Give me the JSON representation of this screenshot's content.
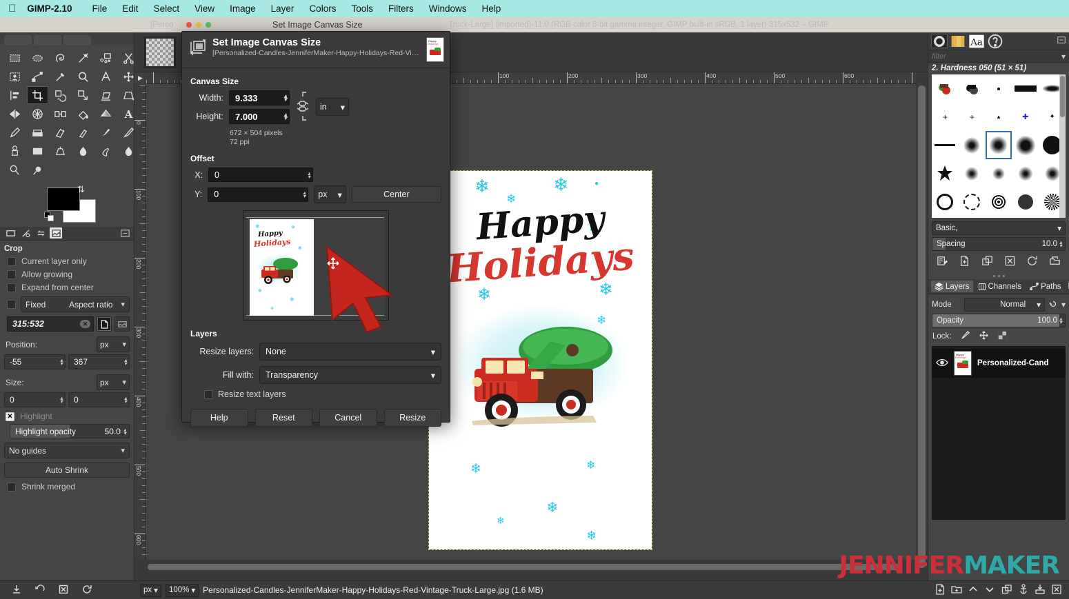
{
  "macbar": {
    "apple_icon": "apple-icon",
    "app_name": "GIMP-2.10",
    "menus": [
      "File",
      "Edit",
      "Select",
      "View",
      "Image",
      "Layer",
      "Colors",
      "Tools",
      "Filters",
      "Windows",
      "Help"
    ]
  },
  "titlebar": {
    "left_text": "[Perso",
    "center_text": "Set Image Canvas Size",
    "right_text": "Truck-Large] (imported)-11.0 (RGB color 8-bit gamma integer, GIMP built-in sRGB, 1 layer) 315x532 – GIMP",
    "close_color": "#f2544a",
    "min_color": "#f3bd4e",
    "max_color": "#5ec45a"
  },
  "toolbox": {
    "tools": [
      "rect-select-icon",
      "ellipse-select-icon",
      "free-select-icon",
      "fuzzy-select-icon",
      "select-by-color-icon",
      "scissors-select-icon",
      "foreground-select-icon",
      "paths-icon",
      "color-picker-icon",
      "zoom-icon",
      "measure-icon",
      "move-icon",
      "alignment-icon",
      "crop-icon",
      "rotate-icon",
      "scale-icon",
      "shear-icon",
      "perspective-icon",
      "flip-icon",
      "cage-transform-icon",
      "warp-transform-icon",
      "bucket-fill-icon",
      "gradient-icon",
      "text-icon",
      "pencil-icon",
      "paintbrush-icon",
      "eraser-icon",
      "airbrush-icon",
      "ink-icon",
      "mypaint-brush-icon",
      "clone-icon",
      "heal-icon",
      "perspective-clone-icon",
      "blur-sharpen-icon",
      "smudge-icon",
      "dodge-burn-icon"
    ],
    "selected_tool": "crop-icon",
    "foreground_color": "#000000",
    "background_color": "#ffffff"
  },
  "tool_options": {
    "title": "Crop",
    "checkboxes": [
      {
        "label": "Current layer only",
        "checked": false
      },
      {
        "label": "Allow growing",
        "checked": false
      },
      {
        "label": "Expand from center",
        "checked": false
      }
    ],
    "fixed_label": "Fixed",
    "fixed_checked": false,
    "fixed_mode": "Aspect ratio",
    "ratio_value": "315:532",
    "position_label": "Position:",
    "position_unit": "px",
    "position_x": "-55",
    "position_y": "367",
    "size_label": "Size:",
    "size_unit": "px",
    "size_w": "0",
    "size_h": "0",
    "highlight_label": "Highlight",
    "highlight_checked": true,
    "highlight_opacity_label": "Highlight opacity",
    "highlight_opacity_value": "50.0",
    "guides": "No guides",
    "auto_shrink": "Auto Shrink",
    "shrink_merged_label": "Shrink merged",
    "shrink_merged_checked": false
  },
  "dialog": {
    "title": "Set Image Canvas Size",
    "subtitle": "[Personalized-Candles-JenniferMaker-Happy-Holidays-Red-Vintag…",
    "canvas_size": {
      "section": "Canvas Size",
      "width_label": "Width:",
      "width_value": "9.333",
      "height_label": "Height:",
      "height_value": "7.000",
      "unit": "in",
      "pixels_info": "672 × 504 pixels",
      "ppi_info": "72 ppi"
    },
    "offset": {
      "section": "Offset",
      "x_label": "X:",
      "x_value": "0",
      "y_label": "Y:",
      "y_value": "0",
      "unit": "px",
      "center_button": "Center"
    },
    "layers": {
      "section": "Layers",
      "resize_layers_label": "Resize layers:",
      "resize_layers_value": "None",
      "fill_with_label": "Fill with:",
      "fill_with_value": "Transparency",
      "resize_text_layers_label": "Resize text layers",
      "resize_text_layers_checked": false
    },
    "buttons": {
      "help": "Help",
      "reset": "Reset",
      "cancel": "Cancel",
      "resize": "Resize"
    }
  },
  "canvas": {
    "h_ruler_ticks": [
      "100",
      "200",
      "300",
      "400",
      "500",
      "600"
    ],
    "v_ruler_ticks": [
      "0",
      "0",
      "100",
      "200",
      "300",
      "400",
      "500"
    ],
    "card": {
      "title_line1": "Happy",
      "title_line2": "Holidays",
      "title1_color": "#111111",
      "title2_color": "#d6372e",
      "snowflake_color": "#29c8e0"
    }
  },
  "statusbar": {
    "unit": "px",
    "zoom": "100%",
    "filename": "Personalized-Candles-JenniferMaker-Happy-Holidays-Red-Vintage-Truck-Large.jpg (1.6 MB)"
  },
  "left_bottom_icons": [
    "save-icon",
    "undo-icon",
    "cancel-icon",
    "refresh-icon"
  ],
  "dock": {
    "tabs": [
      "brushes-icon",
      "patterns-icon",
      "fonts-icon",
      "help-icon"
    ],
    "active_tab": "brushes-icon",
    "menu_icon": "dock-menu-icon",
    "filter_placeholder": "filter",
    "brush_label": "2. Hardness 050 (51 × 51)",
    "brush_set": "Basic,",
    "spacing_label": "Spacing",
    "spacing_value": "10.0",
    "brush_buttons": [
      "edit-brush-icon",
      "new-brush-icon",
      "duplicate-brush-icon",
      "delete-brush-icon",
      "refresh-brushes-icon",
      "open-brush-folder-icon"
    ],
    "layer_tabs": [
      {
        "label": "Layers",
        "icon": "layers-icon",
        "active": true
      },
      {
        "label": "Channels",
        "icon": "channels-icon",
        "active": false
      },
      {
        "label": "Paths",
        "icon": "paths-icon",
        "active": false
      }
    ],
    "mode_label": "Mode",
    "mode_value": "Normal",
    "opacity_label": "Opacity",
    "opacity_value": "100.0",
    "lock_label": "Lock:",
    "lock_icons": [
      "lock-pixels-icon",
      "lock-position-icon",
      "lock-alpha-icon"
    ],
    "layer_row": {
      "visible": true,
      "name": "Personalized-Cand",
      "eye_icon": "eye-icon"
    },
    "bottom_icons": [
      "new-layer-icon",
      "new-layer-group-icon",
      "raise-layer-icon",
      "lower-layer-icon",
      "duplicate-layer-icon",
      "anchor-layer-icon",
      "merge-down-icon",
      "delete-layer-icon"
    ]
  },
  "watermark": {
    "red_part": "JENNIFER",
    "teal_part": "MAKER",
    "red_color": "#cc2f3a",
    "teal_color": "#2fa8a8"
  }
}
